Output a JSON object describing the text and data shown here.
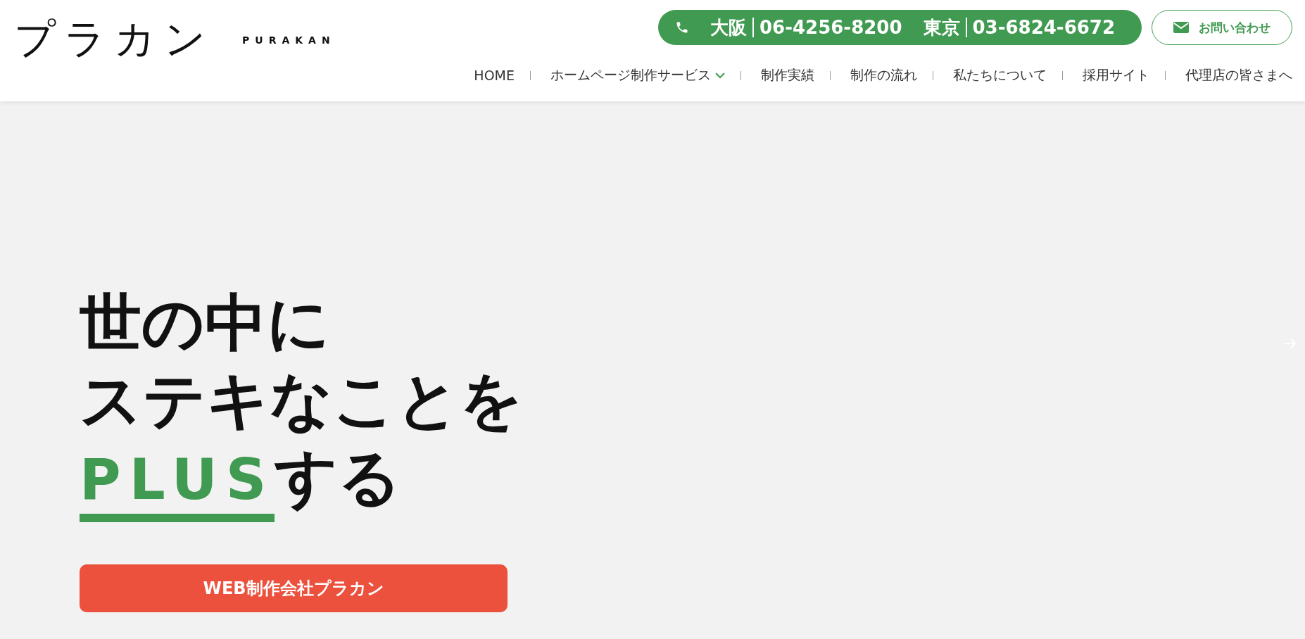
{
  "header": {
    "logo": {
      "mark": "プラカン",
      "wordmark": "PURAKAN"
    },
    "phones": [
      {
        "city": "大阪",
        "number": "06-4256-8200"
      },
      {
        "city": "東京",
        "number": "03-6824-6672"
      }
    ],
    "contact_button": "お問い合わせ",
    "nav": [
      {
        "label": "HOME",
        "dropdown": false
      },
      {
        "label": "ホームページ制作サービス",
        "dropdown": true
      },
      {
        "label": "制作実績",
        "dropdown": false
      },
      {
        "label": "制作の流れ",
        "dropdown": false
      },
      {
        "label": "私たちについて",
        "dropdown": false
      },
      {
        "label": "採用サイト",
        "dropdown": false
      },
      {
        "label": "代理店の皆さまへ",
        "dropdown": false
      }
    ]
  },
  "hero": {
    "heading_lines": [
      "世の中に",
      "ステキなことを"
    ],
    "highlight": "PLUS",
    "highlight_suffix": "する",
    "cta_button": "WEB制作会社プラカン"
  }
}
